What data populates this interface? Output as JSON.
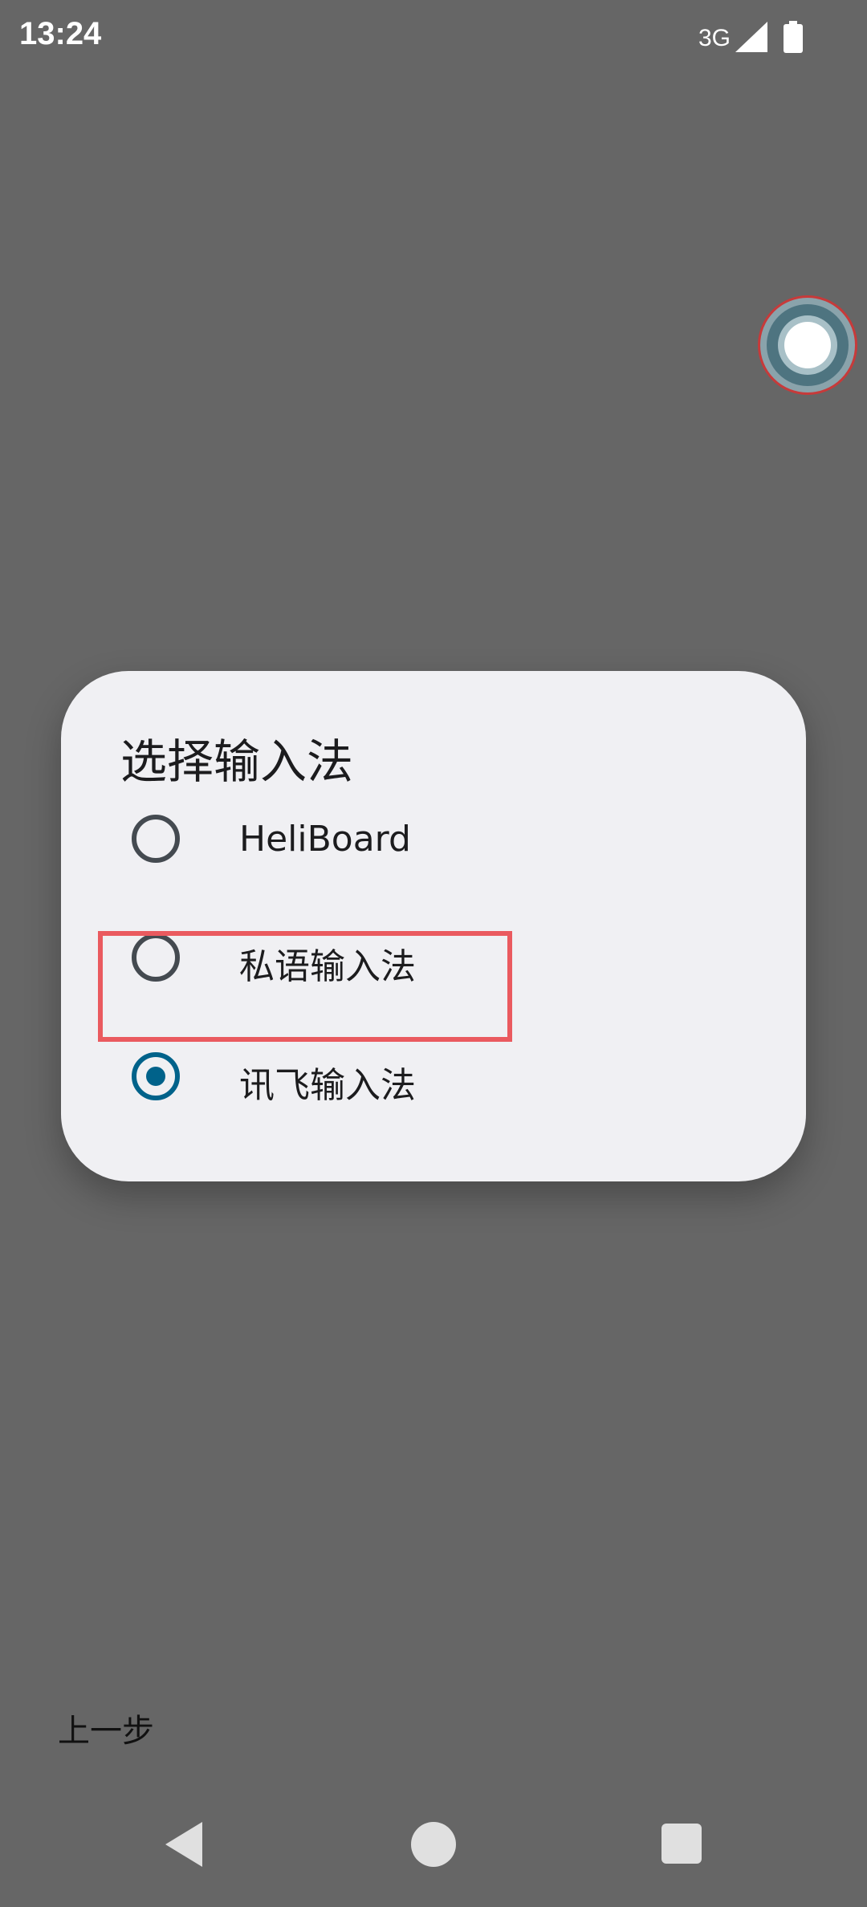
{
  "status_bar": {
    "time": "13:24",
    "network": "3G",
    "signal_icon": "signal-icon",
    "battery_icon": "battery-icon"
  },
  "floating_button": {
    "icon": "floating-bubble-icon"
  },
  "dialog": {
    "title": "选择输入法",
    "options": [
      {
        "label": "HeliBoard",
        "selected": false
      },
      {
        "label": "私语输入法",
        "selected": false,
        "highlighted": true
      },
      {
        "label": "讯飞输入法",
        "selected": true
      }
    ]
  },
  "footer": {
    "back_step_label": "上一步"
  },
  "nav_bar": {
    "back_icon": "nav-back-icon",
    "home_icon": "nav-home-icon",
    "recents_icon": "nav-recents-icon"
  },
  "colors": {
    "backdrop": "#666666",
    "dialog_bg": "#f0f0f3",
    "radio_selected": "#00628a",
    "highlight": "#ea5a5f"
  }
}
